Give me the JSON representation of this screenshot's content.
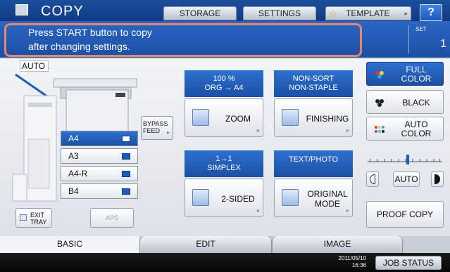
{
  "app": {
    "title": "COPY"
  },
  "topbar": {
    "storage": "STORAGE",
    "settings": "SETTINGS",
    "template": "TEMPLATE",
    "help": "?"
  },
  "message": {
    "line1": "Press START button to copy",
    "line2": "after changing settings."
  },
  "set": {
    "label": "SET",
    "value": "1"
  },
  "auto_tag": "AUTO",
  "trays": [
    {
      "label": "A4",
      "selected": true
    },
    {
      "label": "A3",
      "selected": false
    },
    {
      "label": "A4-R",
      "selected": false
    },
    {
      "label": "B4",
      "selected": false
    }
  ],
  "bypass": {
    "line1": "BYPASS",
    "line2": "FEED"
  },
  "exit_tray": {
    "line1": "EXIT",
    "line2": "TRAY"
  },
  "aps": "APS",
  "zoom": {
    "line1": "100 %",
    "line2": "ORG  →  A4",
    "button": "ZOOM"
  },
  "finishing": {
    "line1": "NON-SORT",
    "line2": "NON-STAPLE",
    "button": "FINISHING"
  },
  "sided": {
    "line1": "1→1",
    "line2": "SIMPLEX",
    "button": "2-SIDED"
  },
  "original": {
    "line1": "TEXT/PHOTO",
    "button_line1": "ORIGINAL",
    "button_line2": "MODE"
  },
  "color": {
    "full": {
      "line1": "FULL",
      "line2": "COLOR",
      "selected": true
    },
    "black": {
      "label": "BLACK"
    },
    "auto": {
      "line1": "AUTO",
      "line2": "COLOR"
    }
  },
  "density": {
    "auto": "AUTO",
    "level": 0.55
  },
  "proof_copy": "PROOF COPY",
  "tabs": [
    "BASIC",
    "EDIT",
    "IMAGE"
  ],
  "datetime": {
    "date": "2011/05/10",
    "time": "16:36"
  },
  "job_status": "JOB STATUS",
  "colors": {
    "accent_blue": "#1b50a4",
    "highlight": "#e6866a"
  }
}
